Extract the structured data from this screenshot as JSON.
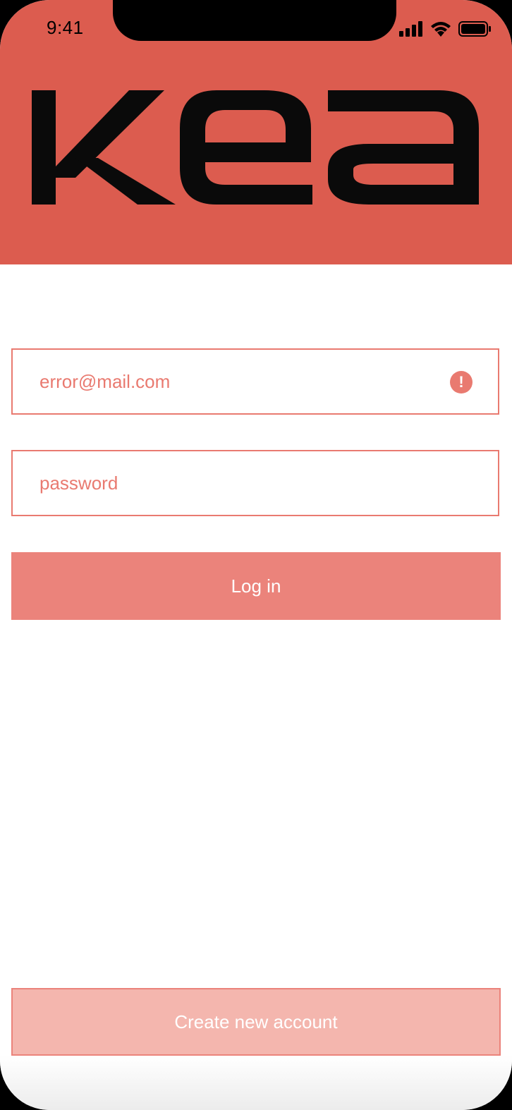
{
  "status_bar": {
    "time": "9:41"
  },
  "brand": {
    "logo_text": "kea",
    "color": "#dc5c4f"
  },
  "login_form": {
    "email_value": "error@mail.com",
    "email_state": "error",
    "error_icon": "exclamation-circle-icon",
    "password_placeholder": "password",
    "login_label": "Log in",
    "accent_color": "#e97a70"
  },
  "footer": {
    "create_account_label": "Create new account"
  }
}
